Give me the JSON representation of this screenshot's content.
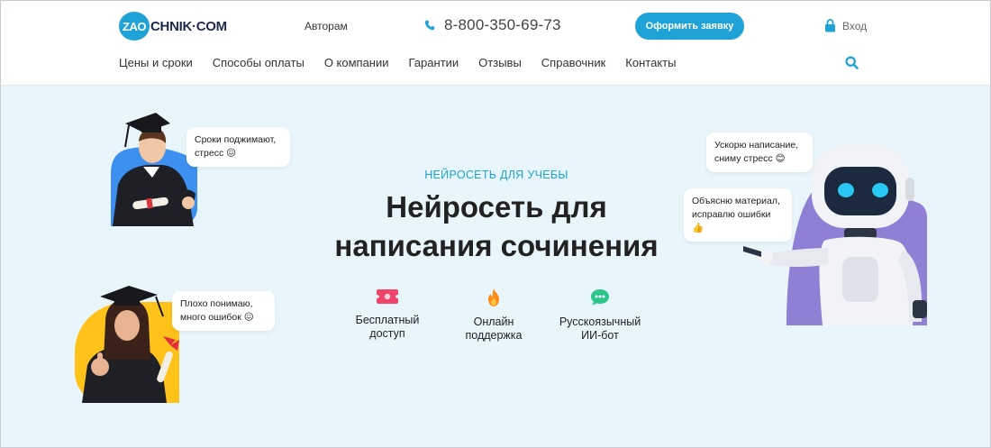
{
  "header": {
    "logo": {
      "circle_text": "ZAO",
      "rest_text": "CHNIK·COM"
    },
    "authors_link": "Авторам",
    "phone": "8-800-350-69-73",
    "cta_label": "Оформить заявку",
    "login_label": "Вход",
    "nav": [
      "Цены и сроки",
      "Способы оплаты",
      "О компании",
      "Гарантии",
      "Отзывы",
      "Справочник",
      "Контакты"
    ]
  },
  "hero": {
    "eyebrow": "НЕЙРОСЕТЬ ДЛЯ УЧЕБЫ",
    "title_line1": "Нейросеть для",
    "title_line2": "написания сочинения",
    "bubbles": {
      "student_male": [
        "Сроки поджимают,",
        "стресс 😖"
      ],
      "student_female": [
        "Плохо понимаю,",
        "много ошибок 😖"
      ],
      "robot_top": [
        "Ускорю написание,",
        "сниму стресс 😊"
      ],
      "robot_bottom": [
        "Объясню материал,",
        "исправлю ошибки 👍"
      ]
    },
    "features": [
      {
        "icon": "ticket-icon",
        "line1": "Бесплатный",
        "line2": "доступ"
      },
      {
        "icon": "flame-icon",
        "line1": "Онлайн",
        "line2": "поддержка"
      },
      {
        "icon": "chat-icon",
        "line1": "Русскоязычный",
        "line2": "ИИ-бот"
      }
    ]
  },
  "colors": {
    "accent": "#1fa2d6",
    "hero_bg": "#e8f6fc",
    "male_circle": "#3d8ff0",
    "female_circle": "#ffc21a",
    "robot_circle": "#8f80d6"
  }
}
